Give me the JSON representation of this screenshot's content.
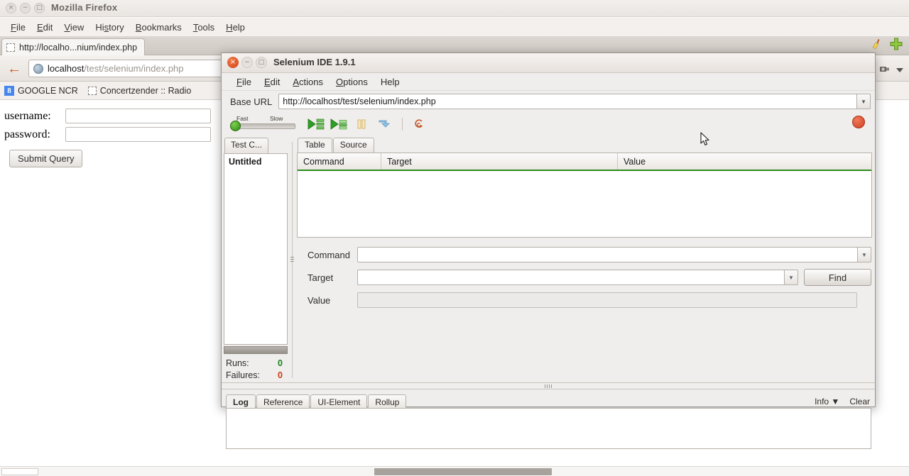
{
  "firefox": {
    "window_title": "Mozilla Firefox",
    "window_buttons": {
      "close": "×",
      "minimize": "−",
      "maximize": "□"
    },
    "menu": [
      {
        "label": "File",
        "accel": "F"
      },
      {
        "label": "Edit",
        "accel": "E"
      },
      {
        "label": "View",
        "accel": "V"
      },
      {
        "label": "History",
        "accel": "s"
      },
      {
        "label": "Bookmarks",
        "accel": "B"
      },
      {
        "label": "Tools",
        "accel": "T"
      },
      {
        "label": "Help",
        "accel": "H"
      }
    ],
    "tab": {
      "title": "http://localho...nium/index.php",
      "favicon": "blank-favicon"
    },
    "toolbar_icons": {
      "broom": "broom-icon",
      "new_tab": "green-plus-icon",
      "back": "←"
    },
    "urlbar": {
      "host": "localhost",
      "path": "/test/selenium/index.php",
      "full": "localhost/test/selenium/index.php"
    },
    "bookmarks": [
      {
        "label": "GOOGLE NCR",
        "icon": "google-favicon"
      },
      {
        "label": "Concertzender :: Radio",
        "icon": "blank-favicon"
      }
    ],
    "page": {
      "fields": [
        {
          "label": "username:",
          "value": ""
        },
        {
          "label": "password:",
          "value": ""
        }
      ],
      "submit_label": "Submit Query"
    }
  },
  "selenium_ide": {
    "window_title": "Selenium IDE 1.9.1",
    "window_buttons": {
      "close": "×",
      "minimize": "−",
      "maximize": "□"
    },
    "menu": [
      {
        "label": "File",
        "accel": "F"
      },
      {
        "label": "Edit",
        "accel": "E"
      },
      {
        "label": "Actions",
        "accel": "A"
      },
      {
        "label": "Options",
        "accel": "O"
      },
      {
        "label": "Help",
        "accel": "H"
      }
    ],
    "base_url": {
      "label": "Base URL",
      "value": "http://localhost/test/selenium/index.php"
    },
    "toolbar": {
      "speed_fast_label": "Fast",
      "speed_slow_label": "Slow",
      "speed_value": 0,
      "buttons": [
        {
          "name": "play-entire-test-suite",
          "icon": "play-suite-icon"
        },
        {
          "name": "play-current-test-case",
          "icon": "play-case-icon"
        },
        {
          "name": "pause-resume",
          "icon": "pause-icon"
        },
        {
          "name": "step",
          "icon": "step-icon"
        },
        {
          "name": "apply-rollup-rules",
          "icon": "rollup-icon"
        }
      ],
      "record_button": "record-icon"
    },
    "testcase_panel": {
      "tab_label": "Test C...",
      "items": [
        "Untitled"
      ],
      "stats": [
        {
          "label": "Runs:",
          "value": "0"
        },
        {
          "label": "Failures:",
          "value": "0"
        }
      ]
    },
    "editor": {
      "tabs": [
        {
          "label": "Table",
          "active": true
        },
        {
          "label": "Source",
          "active": false
        }
      ],
      "table_headers": [
        "Command",
        "Target",
        "Value"
      ],
      "rows": []
    },
    "command_form": {
      "fields": [
        {
          "label": "Command",
          "value": "",
          "has_dropdown": true,
          "readonly": false
        },
        {
          "label": "Target",
          "value": "",
          "has_dropdown": true,
          "readonly": false
        },
        {
          "label": "Value",
          "value": "",
          "has_dropdown": false,
          "readonly": true
        }
      ],
      "find_label": "Find"
    },
    "log_panel": {
      "tabs": [
        {
          "label": "Log",
          "active": true
        },
        {
          "label": "Reference",
          "active": false
        },
        {
          "label": "UI-Element",
          "active": false
        },
        {
          "label": "Rollup",
          "active": false
        }
      ],
      "level_label": "Info",
      "clear_label": "Clear",
      "entries": []
    }
  },
  "colors": {
    "accent_green": "#2b8a1f",
    "record_red": "#cf4223",
    "runs_green": "#16821a",
    "failures_red": "#cc3a15",
    "chrome_bg": "#f0eeec"
  }
}
